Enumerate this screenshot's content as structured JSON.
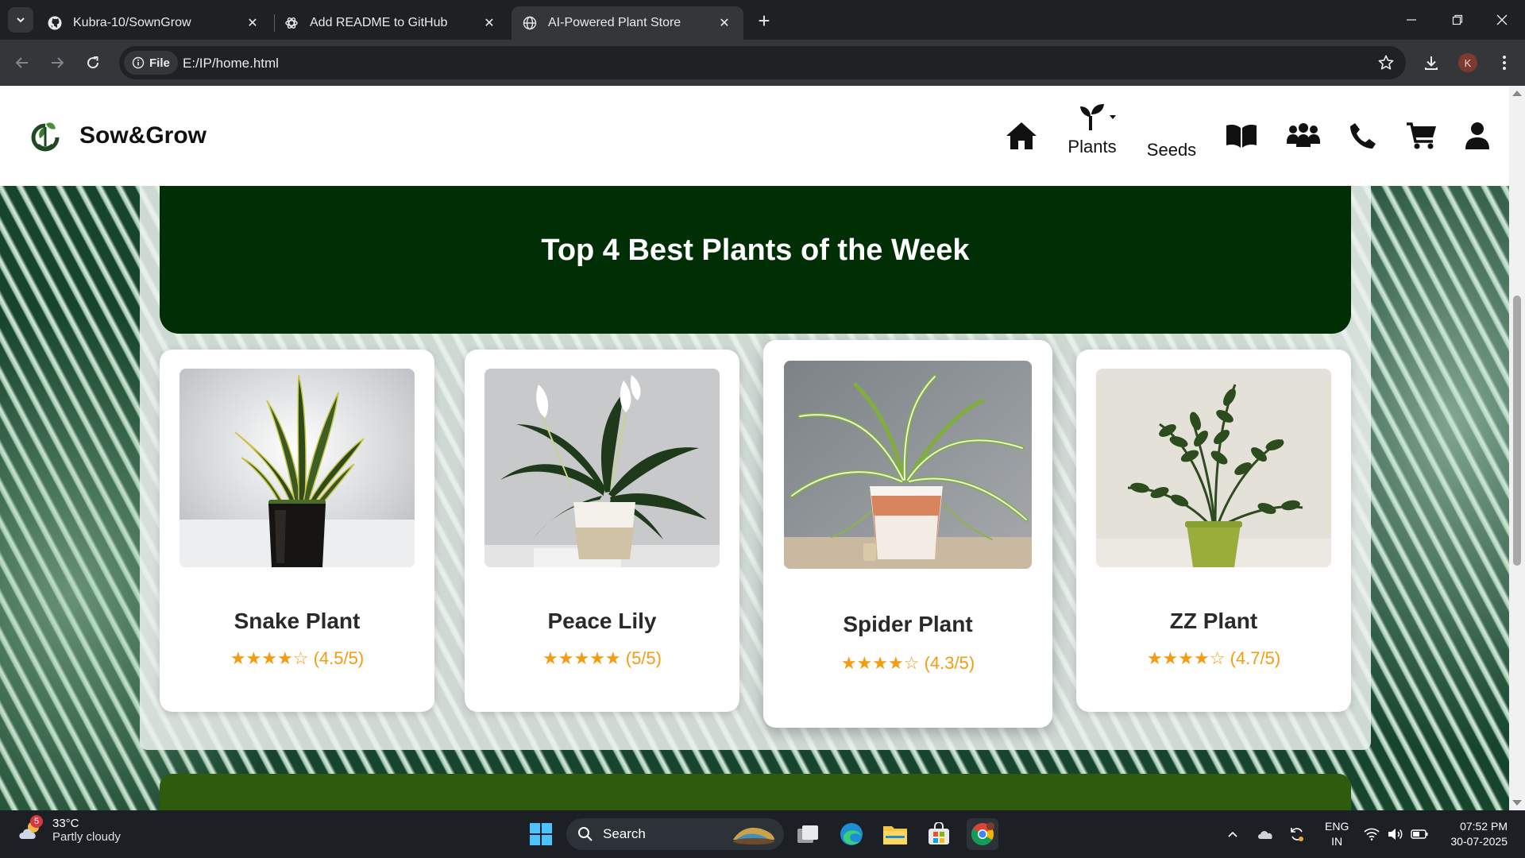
{
  "browser": {
    "tabs": [
      {
        "title": "Kubra-10/SownGrow",
        "icon": "github-icon",
        "active": false
      },
      {
        "title": "Add README to GitHub",
        "icon": "chatgpt-icon",
        "active": false
      },
      {
        "title": "AI-Powered Plant Store",
        "icon": "globe-icon",
        "active": true
      }
    ],
    "url_chip": "File",
    "url": "E:/IP/home.html",
    "profile_initial": "K"
  },
  "site": {
    "brand": "Sow&Grow",
    "nav": {
      "plants": "Plants",
      "seeds": "Seeds"
    },
    "banner_title": "Top 4 Best Plants of the Week",
    "plants": [
      {
        "name": "Snake Plant",
        "stars": "★★★★☆",
        "rating": "(4.5/5)"
      },
      {
        "name": "Peace Lily",
        "stars": "★★★★★",
        "rating": "(5/5)"
      },
      {
        "name": "Spider Plant",
        "stars": "★★★★☆",
        "rating": "(4.3/5)"
      },
      {
        "name": "ZZ Plant",
        "stars": "★★★★☆",
        "rating": "(4.7/5)"
      }
    ]
  },
  "taskbar": {
    "weather_temp": "33°C",
    "weather_desc": "Partly cloudy",
    "weather_badge": "5",
    "search_label": "Search",
    "lang_top": "ENG",
    "lang_bottom": "IN",
    "time": "07:52 PM",
    "date": "30-07-2025"
  }
}
